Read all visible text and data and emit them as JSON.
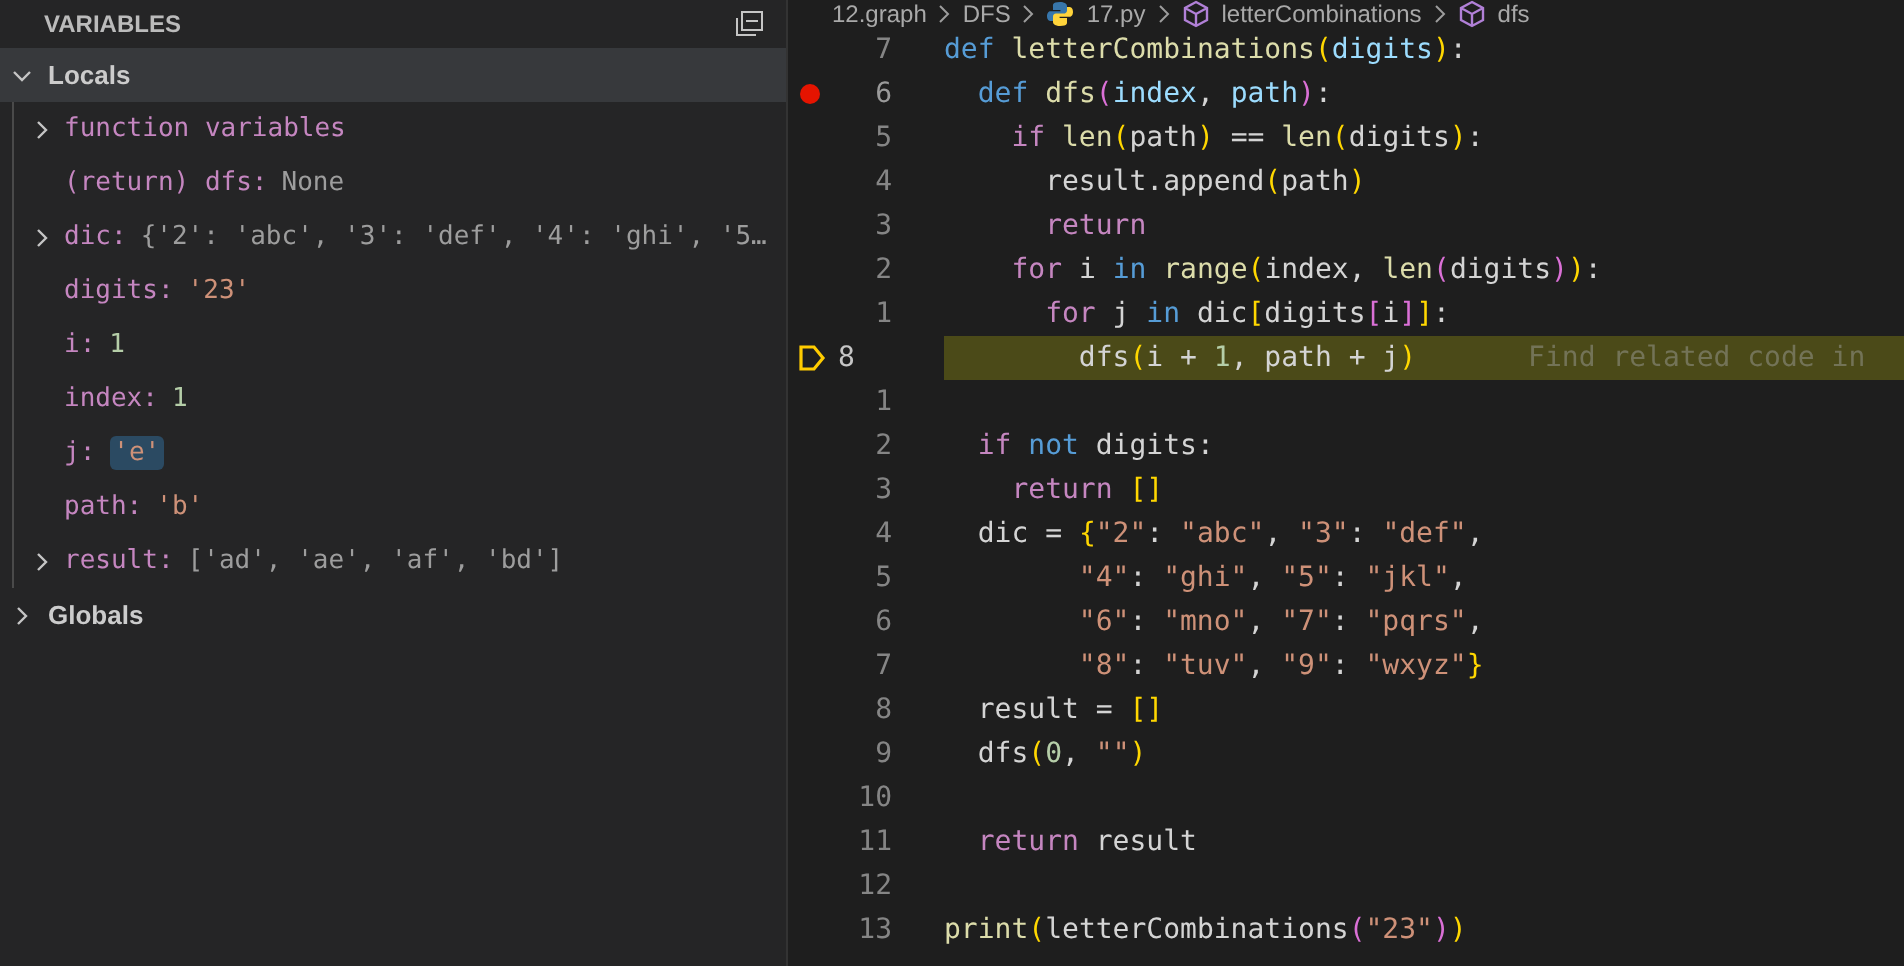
{
  "variables_panel": {
    "title": "VARIABLES",
    "scopes": [
      {
        "name": "Locals",
        "expanded": true,
        "selected": true,
        "variables": [
          {
            "name": "function variables",
            "kind": "group",
            "expandable": true,
            "changed": false
          },
          {
            "name": "(return) dfs:",
            "value": "None",
            "kind": "none",
            "expandable": false,
            "changed": false
          },
          {
            "name": "dic:",
            "value": "{'2': 'abc', '3': 'def', '4': 'ghi', '5…",
            "kind": "object",
            "expandable": true,
            "changed": false
          },
          {
            "name": "digits:",
            "value": "'23'",
            "kind": "string",
            "expandable": false,
            "changed": false
          },
          {
            "name": "i:",
            "value": "1",
            "kind": "number",
            "expandable": false,
            "changed": false
          },
          {
            "name": "index:",
            "value": "1",
            "kind": "number",
            "expandable": false,
            "changed": false
          },
          {
            "name": "j:",
            "value": "'e'",
            "kind": "string",
            "expandable": false,
            "changed": true
          },
          {
            "name": "path:",
            "value": "'b'",
            "kind": "string",
            "expandable": false,
            "changed": false
          },
          {
            "name": "result:",
            "value": "['ad', 'ae', 'af', 'bd']",
            "kind": "object",
            "expandable": true,
            "changed": false
          }
        ]
      },
      {
        "name": "Globals",
        "expanded": false,
        "selected": false
      }
    ]
  },
  "breadcrumb": [
    {
      "label": "12.graph",
      "kind": "folder"
    },
    {
      "label": "DFS",
      "kind": "folder"
    },
    {
      "label": "17.py",
      "kind": "python"
    },
    {
      "label": "letterCombinations",
      "kind": "symbol"
    },
    {
      "label": "dfs",
      "kind": "symbol"
    }
  ],
  "editor": {
    "lines": [
      {
        "number": "7",
        "breakpoint": false,
        "current": false,
        "tokens": [
          {
            "text": "def",
            "kind": "keyword"
          },
          {
            "text": " letterCombinations",
            "kind": "function"
          },
          {
            "text": "(",
            "kind": "bracket1"
          },
          {
            "text": "digits",
            "kind": "param"
          },
          {
            "text": ")",
            "kind": "bracket1"
          },
          {
            "text": ":",
            "kind": "plain"
          }
        ]
      },
      {
        "number": "6",
        "breakpoint": true,
        "current": false,
        "tokens": [
          {
            "text": "  def",
            "kind": "keyword"
          },
          {
            "text": " dfs",
            "kind": "function"
          },
          {
            "text": "(",
            "kind": "bracket2"
          },
          {
            "text": "index",
            "kind": "param"
          },
          {
            "text": ", ",
            "kind": "plain"
          },
          {
            "text": "path",
            "kind": "param"
          },
          {
            "text": ")",
            "kind": "bracket2"
          },
          {
            "text": ":",
            "kind": "plain"
          }
        ]
      },
      {
        "number": "5",
        "breakpoint": false,
        "current": false,
        "tokens": [
          {
            "text": "    if",
            "kind": "control"
          },
          {
            "text": " len",
            "kind": "function"
          },
          {
            "text": "(",
            "kind": "bracket1"
          },
          {
            "text": "path",
            "kind": "plain"
          },
          {
            "text": ")",
            "kind": "bracket1"
          },
          {
            "text": " == ",
            "kind": "plain"
          },
          {
            "text": "len",
            "kind": "function"
          },
          {
            "text": "(",
            "kind": "bracket1"
          },
          {
            "text": "digits",
            "kind": "plain"
          },
          {
            "text": ")",
            "kind": "bracket1"
          },
          {
            "text": ":",
            "kind": "plain"
          }
        ]
      },
      {
        "number": "4",
        "breakpoint": false,
        "current": false,
        "tokens": [
          {
            "text": "      result.append",
            "kind": "plain"
          },
          {
            "text": "(",
            "kind": "bracket1"
          },
          {
            "text": "path",
            "kind": "plain"
          },
          {
            "text": ")",
            "kind": "bracket1"
          }
        ]
      },
      {
        "number": "3",
        "breakpoint": false,
        "current": false,
        "tokens": [
          {
            "text": "      return",
            "kind": "control"
          }
        ]
      },
      {
        "number": "2",
        "breakpoint": false,
        "current": false,
        "tokens": [
          {
            "text": "    for",
            "kind": "control"
          },
          {
            "text": " i ",
            "kind": "plain"
          },
          {
            "text": "in",
            "kind": "keyword"
          },
          {
            "text": " range",
            "kind": "function"
          },
          {
            "text": "(",
            "kind": "bracket1"
          },
          {
            "text": "index, ",
            "kind": "plain"
          },
          {
            "text": "len",
            "kind": "function"
          },
          {
            "text": "(",
            "kind": "bracket2"
          },
          {
            "text": "digits",
            "kind": "plain"
          },
          {
            "text": ")",
            "kind": "bracket2"
          },
          {
            "text": ")",
            "kind": "bracket1"
          },
          {
            "text": ":",
            "kind": "plain"
          }
        ]
      },
      {
        "number": "1",
        "breakpoint": false,
        "current": false,
        "tokens": [
          {
            "text": "      for",
            "kind": "control"
          },
          {
            "text": " j ",
            "kind": "plain"
          },
          {
            "text": "in",
            "kind": "keyword"
          },
          {
            "text": " dic",
            "kind": "plain"
          },
          {
            "text": "[",
            "kind": "bracket1"
          },
          {
            "text": "digits",
            "kind": "plain"
          },
          {
            "text": "[",
            "kind": "bracket2"
          },
          {
            "text": "i",
            "kind": "plain"
          },
          {
            "text": "]",
            "kind": "bracket2"
          },
          {
            "text": "]",
            "kind": "bracket1"
          },
          {
            "text": ":",
            "kind": "plain"
          }
        ]
      },
      {
        "number": "8",
        "breakpoint": false,
        "current": true,
        "hint": "Find related code in",
        "tokens": [
          {
            "text": "        dfs",
            "kind": "plain"
          },
          {
            "text": "(",
            "kind": "bracket1"
          },
          {
            "text": "i + ",
            "kind": "plain"
          },
          {
            "text": "1",
            "kind": "number"
          },
          {
            "text": ", path + j",
            "kind": "plain"
          },
          {
            "text": ")",
            "kind": "bracket1"
          }
        ]
      },
      {
        "number": "1",
        "breakpoint": false,
        "current": false
      },
      {
        "number": "2",
        "breakpoint": false,
        "current": false,
        "tokens": [
          {
            "text": "  if",
            "kind": "control"
          },
          {
            "text": " not",
            "kind": "keyword"
          },
          {
            "text": " digits:",
            "kind": "plain"
          }
        ]
      },
      {
        "number": "3",
        "breakpoint": false,
        "current": false,
        "tokens": [
          {
            "text": "    return",
            "kind": "control"
          },
          {
            "text": " []",
            "kind": "bracket1"
          }
        ]
      },
      {
        "number": "4",
        "breakpoint": false,
        "current": false,
        "tokens": [
          {
            "text": "  dic = ",
            "kind": "plain"
          },
          {
            "text": "{",
            "kind": "bracket1"
          },
          {
            "text": "\"2\"",
            "kind": "string"
          },
          {
            "text": ": ",
            "kind": "plain"
          },
          {
            "text": "\"abc\"",
            "kind": "string"
          },
          {
            "text": ", ",
            "kind": "plain"
          },
          {
            "text": "\"3\"",
            "kind": "string"
          },
          {
            "text": ": ",
            "kind": "plain"
          },
          {
            "text": "\"def\"",
            "kind": "string"
          },
          {
            "text": ",",
            "kind": "plain"
          }
        ]
      },
      {
        "number": "5",
        "breakpoint": false,
        "current": false,
        "tokens": [
          {
            "text": "        \"4\"",
            "kind": "string"
          },
          {
            "text": ": ",
            "kind": "plain"
          },
          {
            "text": "\"ghi\"",
            "kind": "string"
          },
          {
            "text": ", ",
            "kind": "plain"
          },
          {
            "text": "\"5\"",
            "kind": "string"
          },
          {
            "text": ": ",
            "kind": "plain"
          },
          {
            "text": "\"jkl\"",
            "kind": "string"
          },
          {
            "text": ",",
            "kind": "plain"
          }
        ]
      },
      {
        "number": "6",
        "breakpoint": false,
        "current": false,
        "tokens": [
          {
            "text": "        \"6\"",
            "kind": "string"
          },
          {
            "text": ": ",
            "kind": "plain"
          },
          {
            "text": "\"mno\"",
            "kind": "string"
          },
          {
            "text": ", ",
            "kind": "plain"
          },
          {
            "text": "\"7\"",
            "kind": "string"
          },
          {
            "text": ": ",
            "kind": "plain"
          },
          {
            "text": "\"pqrs\"",
            "kind": "string"
          },
          {
            "text": ",",
            "kind": "plain"
          }
        ]
      },
      {
        "number": "7",
        "breakpoint": false,
        "current": false,
        "tokens": [
          {
            "text": "        \"8\"",
            "kind": "string"
          },
          {
            "text": ": ",
            "kind": "plain"
          },
          {
            "text": "\"tuv\"",
            "kind": "string"
          },
          {
            "text": ", ",
            "kind": "plain"
          },
          {
            "text": "\"9\"",
            "kind": "string"
          },
          {
            "text": ": ",
            "kind": "plain"
          },
          {
            "text": "\"wxyz\"",
            "kind": "string"
          },
          {
            "text": "}",
            "kind": "bracket1"
          }
        ]
      },
      {
        "number": "8",
        "breakpoint": false,
        "current": false,
        "tokens": [
          {
            "text": "  result = ",
            "kind": "plain"
          },
          {
            "text": "[]",
            "kind": "bracket1"
          }
        ]
      },
      {
        "number": "9",
        "breakpoint": false,
        "current": false,
        "tokens": [
          {
            "text": "  dfs",
            "kind": "plain"
          },
          {
            "text": "(",
            "kind": "bracket1"
          },
          {
            "text": "0",
            "kind": "number"
          },
          {
            "text": ", ",
            "kind": "plain"
          },
          {
            "text": "\"\"",
            "kind": "string"
          },
          {
            "text": ")",
            "kind": "bracket1"
          }
        ]
      },
      {
        "number": "10",
        "breakpoint": false,
        "current": false
      },
      {
        "number": "11",
        "breakpoint": false,
        "current": false,
        "tokens": [
          {
            "text": "  return",
            "kind": "control"
          },
          {
            "text": " result",
            "kind": "plain"
          }
        ]
      },
      {
        "number": "12",
        "breakpoint": false,
        "current": false
      },
      {
        "number": "13",
        "breakpoint": false,
        "current": false,
        "tokens": [
          {
            "text": "print",
            "kind": "function"
          },
          {
            "text": "(",
            "kind": "bracket1"
          },
          {
            "text": "letterCombinations",
            "kind": "plain"
          },
          {
            "text": "(",
            "kind": "bracket2"
          },
          {
            "text": "\"23\"",
            "kind": "string"
          },
          {
            "text": ")",
            "kind": "bracket2"
          },
          {
            "text": ")",
            "kind": "bracket1"
          }
        ]
      }
    ]
  }
}
